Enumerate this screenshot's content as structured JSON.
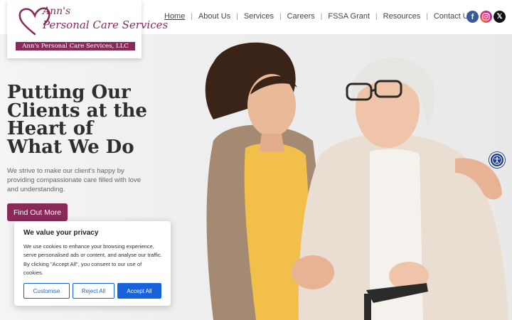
{
  "logo": {
    "script_line1": "Ann's",
    "script_line2": "Personal Care Services",
    "banner": "Ann's Personal Care Services, LLC"
  },
  "nav": {
    "items": [
      {
        "label": "Home"
      },
      {
        "label": "About Us"
      },
      {
        "label": "Services"
      },
      {
        "label": "Careers"
      },
      {
        "label": "FSSA Grant"
      },
      {
        "label": "Resources"
      },
      {
        "label": "Contact Us"
      }
    ],
    "separator": "|"
  },
  "social": {
    "facebook_glyph": "f",
    "x_glyph": "𝕏"
  },
  "hero": {
    "headline": [
      "Putting Our",
      "Clients at the",
      "Heart of",
      "What We Do"
    ],
    "subtext": "We strive to make our client's happy by providing compassionate care filled with love and understanding.",
    "cta_label": "Find Out More"
  },
  "cookie": {
    "title": "We value your privacy",
    "body": "We use cookies to enhance your browsing experience, serve personalised ads or content, and analyse our traffic. By clicking \"Accept All\", you consent to our use of cookies.",
    "customise_label": "Customise",
    "reject_label": "Reject All",
    "accept_label": "Accept All"
  },
  "colors": {
    "brand": "#8a2a5a",
    "cookie_button": "#1863dc",
    "accessibility": "#1e3a8a"
  }
}
